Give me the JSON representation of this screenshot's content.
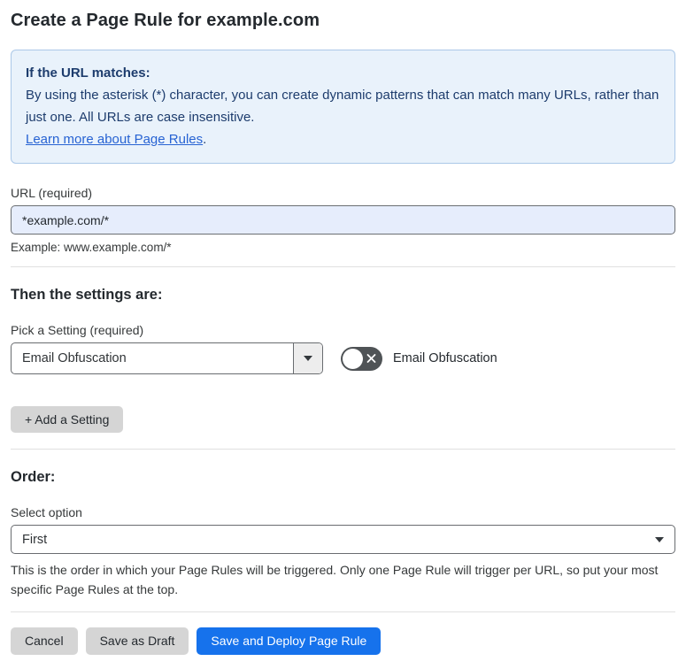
{
  "page": {
    "title": "Create a Page Rule for example.com"
  },
  "info_box": {
    "heading": "If the URL matches:",
    "body": "By using the asterisk (*) character, you can create dynamic patterns that can match many URLs, rather than just one. All URLs are case insensitive.",
    "link_label": "Learn more about Page Rules",
    "link_suffix": "."
  },
  "url_field": {
    "label": "URL (required)",
    "value": "*example.com/*",
    "example": "Example: www.example.com/*"
  },
  "settings_section": {
    "heading": "Then the settings are:",
    "picker_label": "Pick a Setting (required)",
    "picker_value": "Email Obfuscation",
    "toggle_label": "Email Obfuscation",
    "toggle_state": "off",
    "add_setting_label": "+ Add a Setting"
  },
  "order_section": {
    "heading": "Order:",
    "select_label": "Select option",
    "select_value": "First",
    "help_text": "This is the order in which your Page Rules will be triggered. Only one Page Rule will trigger per URL, so put your most specific Page Rules at the top."
  },
  "footer": {
    "cancel_label": "Cancel",
    "save_draft_label": "Save as Draft",
    "save_deploy_label": "Save and Deploy Page Rule"
  },
  "colors": {
    "accent_blue": "#1672ec",
    "info_background": "#e9f2fb",
    "info_border": "#abc8e8",
    "info_text": "#1d3c6d",
    "link_blue": "#2763d3",
    "url_input_background": "#e6edfc",
    "toggle_off_background": "#4f5356",
    "gray_button_background": "#d5d5d5"
  }
}
